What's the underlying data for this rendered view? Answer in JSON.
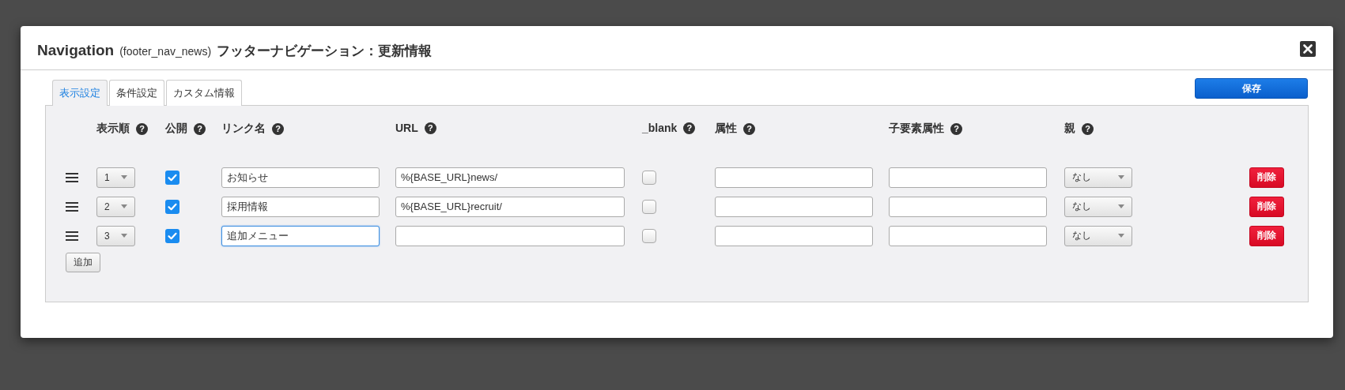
{
  "dialog": {
    "title": "Navigation",
    "code": "(footer_nav_news)",
    "subtitle": "フッターナビゲーション：更新情報"
  },
  "tabs": [
    {
      "label": "表示設定",
      "selected": true
    },
    {
      "label": "条件設定",
      "selected": false
    },
    {
      "label": "カスタム情報",
      "selected": false
    }
  ],
  "save_button": "保存",
  "columns": [
    {
      "label": "表示順",
      "help": "?"
    },
    {
      "label": "公開",
      "help": "?"
    },
    {
      "label": "リンク名",
      "help": "?"
    },
    {
      "label": "URL",
      "help": "?"
    },
    {
      "label": "_blank",
      "help": "?"
    },
    {
      "label": "属性",
      "help": "?"
    },
    {
      "label": "子要素属性",
      "help": "?"
    },
    {
      "label": "親",
      "help": "?"
    }
  ],
  "rows": [
    {
      "order": "1",
      "published": true,
      "name": "お知らせ",
      "name_focused": false,
      "url": "%{BASE_URL}news/",
      "blank": false,
      "parent": "なし",
      "delete": "削除"
    },
    {
      "order": "2",
      "published": true,
      "name": "採用情報",
      "name_focused": false,
      "url": "%{BASE_URL}recruit/",
      "blank": false,
      "parent": "なし",
      "delete": "削除"
    },
    {
      "order": "3",
      "published": true,
      "name": "追加メニュー",
      "name_focused": true,
      "blank": false,
      "parent": "なし",
      "delete": "削除"
    }
  ],
  "add_button": "追加"
}
